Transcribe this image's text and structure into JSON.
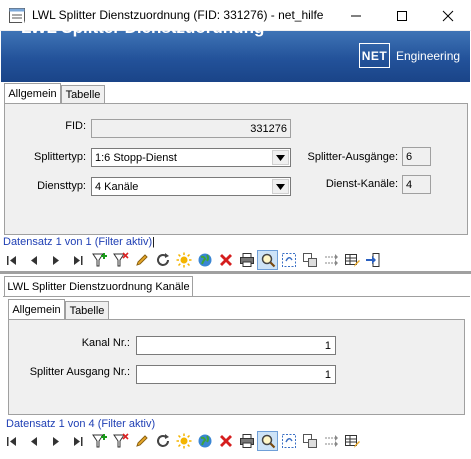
{
  "window": {
    "title": "LWL Splitter Dienstzuordnung (FID: 331276) - net_hilfe",
    "minimize_glyph": "—",
    "maximize_glyph": "☐",
    "close_glyph": "✕"
  },
  "header": {
    "title": "LWL Splitter Dienstzuordnung",
    "logo_mark": "NET",
    "logo_text": "Engineering",
    "accent_color": "#23529a"
  },
  "main_tabs": [
    {
      "label": "Allgemein",
      "active": true
    },
    {
      "label": "Tabelle",
      "active": false
    }
  ],
  "main_form": {
    "fid_label": "FID:",
    "fid_value": "331276",
    "splittertyp_label": "Splittertyp:",
    "splittertyp_value": "1:6 Stopp-Dienst",
    "diensttyp_label": "Diensttyp:",
    "diensttyp_value": "4 Kanäle",
    "splitter_ausgaenge_label": "Splitter-Ausgänge:",
    "splitter_ausgaenge_value": "6",
    "dienst_kanaele_label": "Dienst-Kanäle:",
    "dienst_kanaele_value": "4"
  },
  "main_status": "Datensatz 1 von 1 (Filter aktiv)",
  "sub": {
    "window_tab": "LWL Splitter Dienstzuordnung Kanäle",
    "tabs": [
      {
        "label": "Allgemein",
        "active": true
      },
      {
        "label": "Tabelle",
        "active": false
      }
    ],
    "kanal_label": "Kanal Nr.:",
    "kanal_value": "1",
    "ausgang_label": "Splitter Ausgang Nr.:",
    "ausgang_value": "1",
    "status": "Datensatz 1 von 4 (Filter aktiv)"
  },
  "toolbar_icons": [
    "first-record-icon",
    "prev-record-icon",
    "next-record-icon",
    "last-record-icon",
    "add-filter-icon",
    "remove-filter-icon",
    "edit-pencil-icon",
    "refresh-icon",
    "new-record-icon",
    "globe-icon",
    "delete-icon",
    "print-icon",
    "search-icon",
    "select-icon",
    "copy-icon",
    "move-icon",
    "table-edit-icon",
    "exit-icon"
  ]
}
